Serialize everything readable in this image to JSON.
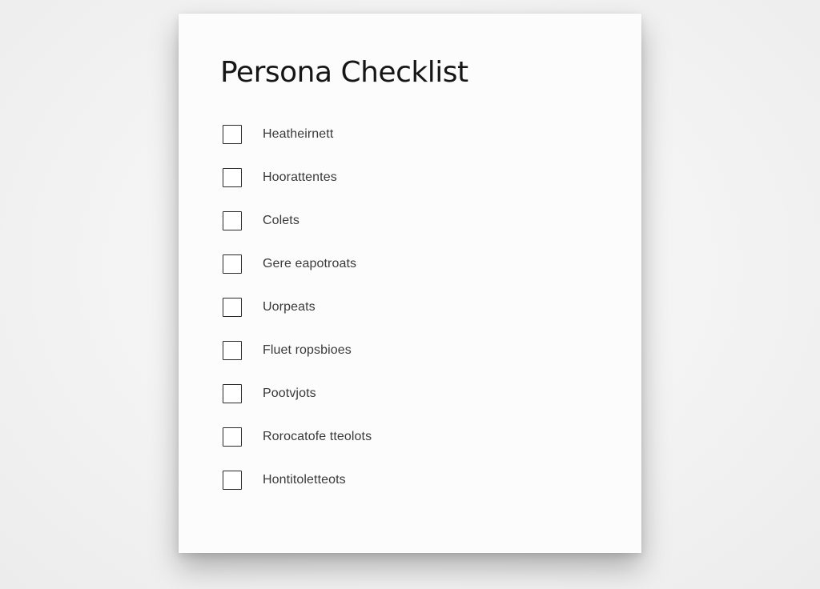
{
  "checklist": {
    "title": "Persona Checklist",
    "items": [
      {
        "label": "Heatheirnett",
        "checked": false
      },
      {
        "label": "Hoorattentes",
        "checked": false
      },
      {
        "label": "Colets",
        "checked": false
      },
      {
        "label": "Gere eapotroats",
        "checked": false
      },
      {
        "label": "Uorpeats",
        "checked": false
      },
      {
        "label": "Fluet ropsbioes",
        "checked": false
      },
      {
        "label": "Pootvjots",
        "checked": false
      },
      {
        "label": "Rorocatofe tteolots",
        "checked": false
      },
      {
        "label": "Hontitoletteots",
        "checked": false
      }
    ]
  }
}
